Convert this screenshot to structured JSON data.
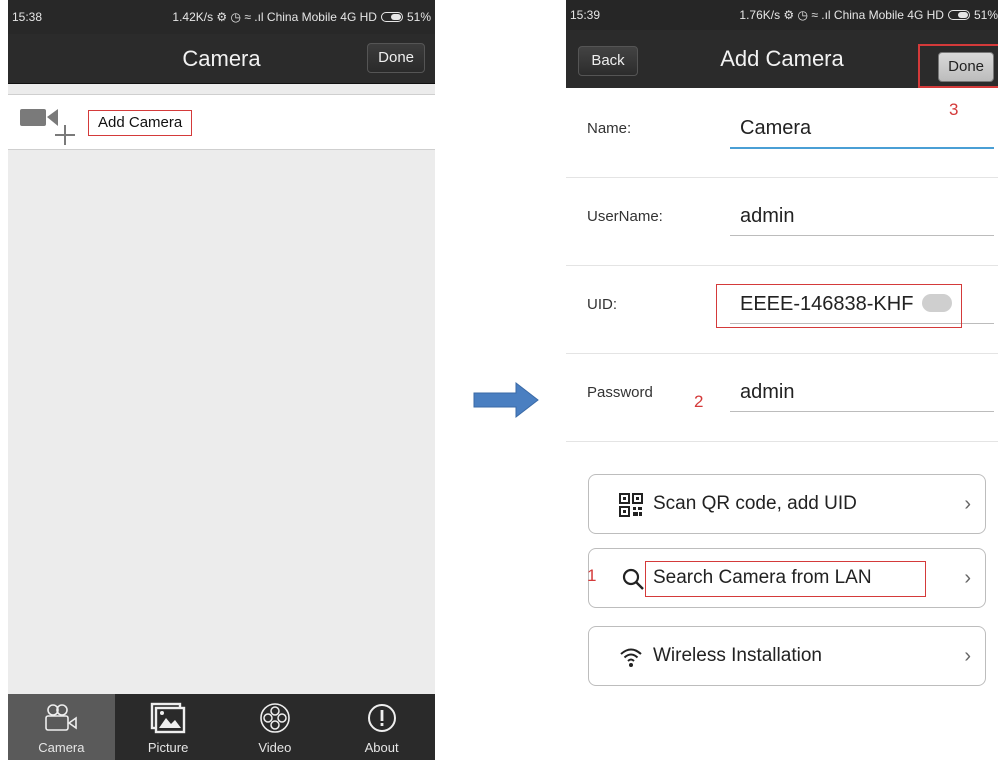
{
  "left": {
    "status": {
      "time": "15:38",
      "right": "1.42K/s ⚙ ◷ ≈ .ıl China Mobile 4G HD",
      "battery": "51%"
    },
    "nav": {
      "title": "Camera",
      "done_label": "Done"
    },
    "add_row": {
      "label": "Add Camera"
    },
    "tabs": [
      {
        "label": "Camera",
        "icon": "camera-icon"
      },
      {
        "label": "Picture",
        "icon": "picture-icon"
      },
      {
        "label": "Video",
        "icon": "film-reel-icon"
      },
      {
        "label": "About",
        "icon": "info-icon"
      }
    ]
  },
  "right": {
    "status": {
      "time": "15:39",
      "right": "1.76K/s ⚙ ◷ ≈ .ıl China Mobile 4G HD",
      "battery": "51%"
    },
    "nav": {
      "back_label": "Back",
      "title": "Add Camera",
      "done_label": "Done"
    },
    "form": [
      {
        "label": "Name:",
        "value": "Camera"
      },
      {
        "label": "UserName:",
        "value": "admin"
      },
      {
        "label": "UID:",
        "value": "EEEE-146838-KHF"
      },
      {
        "label": "Password",
        "value": "admin"
      }
    ],
    "actions": [
      {
        "label": "Scan QR code, add UID",
        "icon": "qr-code-icon"
      },
      {
        "label": "Search Camera from LAN",
        "icon": "search-icon"
      },
      {
        "label": "Wireless Installation",
        "icon": "wifi-icon"
      }
    ],
    "steps": {
      "one": "1",
      "two": "2",
      "three": "3"
    }
  },
  "colors": {
    "annotation": "#d43a3a",
    "arrow": "#4a7fc1",
    "nav": "#2b2b2b",
    "input_focus": "#4a9fd5"
  }
}
